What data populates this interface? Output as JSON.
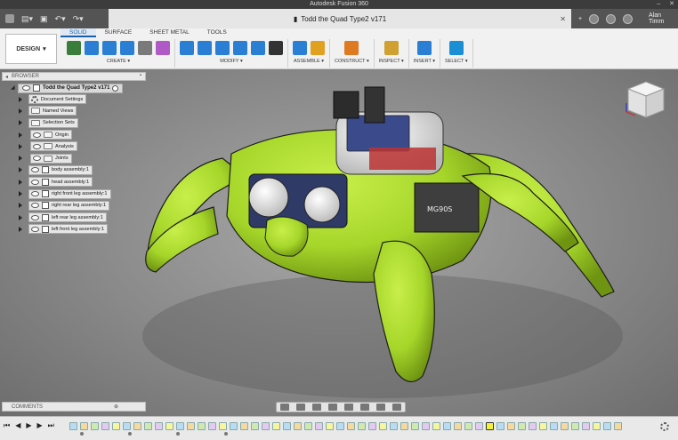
{
  "window": {
    "title": "Autodesk Fusion 360"
  },
  "document_tab": {
    "title": "Todd the Quad Type2 v171"
  },
  "user": {
    "name": "Alan Timm"
  },
  "workspace": {
    "label": "DESIGN"
  },
  "ribbon_tabs": [
    {
      "label": "SOLID",
      "active": true
    },
    {
      "label": "SURFACE",
      "active": false
    },
    {
      "label": "SHEET METAL",
      "active": false
    },
    {
      "label": "TOOLS",
      "active": false
    }
  ],
  "tool_groups": [
    {
      "label": "CREATE ▾",
      "icons": [
        "sketch-icon",
        "extrude-icon",
        "revolve-icon",
        "shell-icon",
        "pattern-icon",
        "form-icon"
      ],
      "colors": [
        "#3a7d3a",
        "#2a7fd4",
        "#2a7fd4",
        "#2a7fd4",
        "#7a7a7a",
        "#b05ac8"
      ]
    },
    {
      "label": "MODIFY ▾",
      "icons": [
        "press-pull-icon",
        "fillet-icon",
        "chamfer-icon",
        "combine-icon",
        "scale-icon",
        "move-icon"
      ],
      "colors": [
        "#2a7fd4",
        "#2a7fd4",
        "#2a7fd4",
        "#2a7fd4",
        "#2a7fd4",
        "#333333"
      ]
    },
    {
      "label": "ASSEMBLE ▾",
      "icons": [
        "new-component-icon",
        "joint-icon"
      ],
      "colors": [
        "#2a7fd4",
        "#e0a020"
      ]
    },
    {
      "label": "CONSTRUCT ▾",
      "icons": [
        "offset-plane-icon"
      ],
      "colors": [
        "#e07a20"
      ]
    },
    {
      "label": "INSPECT ▾",
      "icons": [
        "measure-icon"
      ],
      "colors": [
        "#d0a030"
      ]
    },
    {
      "label": "INSERT ▾",
      "icons": [
        "insert-image-icon"
      ],
      "colors": [
        "#2a7fd4"
      ]
    },
    {
      "label": "SELECT ▾",
      "icons": [
        "select-icon"
      ],
      "colors": [
        "#1a8fd4"
      ]
    }
  ],
  "browser": {
    "title": "BROWSER",
    "root": "Todd the Quad Type2 v171",
    "items": [
      {
        "label": "Document Settings",
        "icon": "gear-icon",
        "eye": false
      },
      {
        "label": "Named Views",
        "icon": "folder-icon",
        "eye": false
      },
      {
        "label": "Selection Sets",
        "icon": "folder-icon",
        "eye": false
      },
      {
        "label": "Origin",
        "icon": "folder-icon",
        "eye": true
      },
      {
        "label": "Analysis",
        "icon": "folder-icon",
        "eye": true
      },
      {
        "label": "Joints",
        "icon": "folder-icon",
        "eye": true
      },
      {
        "label": "body assembly:1",
        "icon": "component-icon",
        "eye": true
      },
      {
        "label": "head assembly:1",
        "icon": "component-icon",
        "eye": true
      },
      {
        "label": "right front leg assembly:1",
        "icon": "component-icon",
        "eye": true
      },
      {
        "label": "right rear leg assembly:1",
        "icon": "component-icon",
        "eye": true
      },
      {
        "label": "left rear leg assembly:1",
        "icon": "component-icon",
        "eye": true
      },
      {
        "label": "left front leg assembly:1",
        "icon": "component-icon",
        "eye": true
      }
    ]
  },
  "comments": {
    "title": "COMMENTS"
  },
  "model": {
    "servo_label": "MG90S",
    "color": "#a6d62a"
  },
  "viewcube": {
    "face": "FRONT"
  },
  "colors": {
    "accent": "#1a5fa8",
    "model_green": "#a6d62a"
  }
}
